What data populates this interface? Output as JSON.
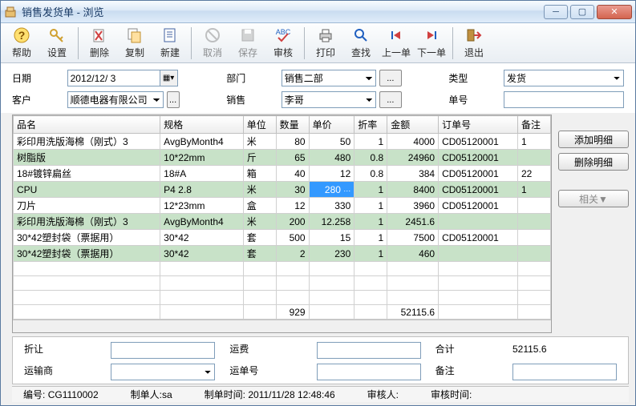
{
  "window_title": "销售发货单 - 浏览",
  "toolbar": {
    "help": "帮助",
    "setup": "设置",
    "delete": "删除",
    "copy": "复制",
    "new": "新建",
    "cancel": "取消",
    "save": "保存",
    "audit": "审核",
    "print": "打印",
    "find": "查找",
    "prev": "上一单",
    "next": "下一单",
    "exit": "退出"
  },
  "form": {
    "date_label": "日期",
    "date_value": "2012/12/ 3",
    "dept_label": "部门",
    "dept_value": "销售二部",
    "type_label": "类型",
    "type_value": "发货",
    "cust_label": "客户",
    "cust_value": "顺德电器有限公司",
    "sale_label": "销售",
    "sale_value": "李哥",
    "doc_label": "单号",
    "doc_value": "",
    "dots": "..."
  },
  "grid": {
    "cols": [
      "品名",
      "规格",
      "单位",
      "数量",
      "单价",
      "折率",
      "金额",
      "订单号",
      "备注"
    ],
    "rows": [
      {
        "name": "彩印用洗版海棉（刚式）3",
        "spec": "AvgByMonth4",
        "unit": "米",
        "qty": "80",
        "price": "50",
        "disc": "1",
        "amt": "4000",
        "ord": "CD05120001",
        "rem": "1"
      },
      {
        "name": "树脂版",
        "spec": "10*22mm",
        "unit": "斤",
        "qty": "65",
        "price": "480",
        "disc": "0.8",
        "amt": "24960",
        "ord": "CD05120001",
        "rem": ""
      },
      {
        "name": "18#镀锌扁丝",
        "spec": "18#A",
        "unit": "箱",
        "qty": "40",
        "price": "12",
        "disc": "0.8",
        "amt": "384",
        "ord": "CD05120001",
        "rem": "22"
      },
      {
        "name": "CPU",
        "spec": "P4 2.8",
        "unit": "米",
        "qty": "30",
        "price": "280",
        "disc": "1",
        "amt": "8400",
        "ord": "CD05120001",
        "rem": "1",
        "editing": "price"
      },
      {
        "name": "刀片",
        "spec": "12*23mm",
        "unit": "盒",
        "qty": "12",
        "price": "330",
        "disc": "1",
        "amt": "3960",
        "ord": "CD05120001",
        "rem": ""
      },
      {
        "name": "彩印用洗版海棉（刚式）3",
        "spec": "AvgByMonth4",
        "unit": "米",
        "qty": "200",
        "price": "12.258",
        "disc": "1",
        "amt": "2451.6",
        "ord": "",
        "rem": ""
      },
      {
        "name": "30*42塑封袋（票据用）",
        "spec": "30*42",
        "unit": "套",
        "qty": "500",
        "price": "15",
        "disc": "1",
        "amt": "7500",
        "ord": "CD05120001",
        "rem": ""
      },
      {
        "name": "30*42塑封袋（票据用）",
        "spec": "30*42",
        "unit": "套",
        "qty": "2",
        "price": "230",
        "disc": "1",
        "amt": "460",
        "ord": "",
        "rem": ""
      }
    ],
    "totals": {
      "qty": "929",
      "amt": "52115.6"
    }
  },
  "side": {
    "add": "添加明细",
    "del": "删除明细",
    "rel": "相关▼"
  },
  "bottom": {
    "discount_label": "折让",
    "discount_value": "",
    "freight_label": "运费",
    "freight_value": "",
    "total_label": "合计",
    "total_value": "52115.6",
    "carrier_label": "运输商",
    "carrier_value": "",
    "waybill_label": "运单号",
    "waybill_value": "",
    "remark_label": "备注",
    "remark_value": ""
  },
  "status": {
    "no_label": "编号:",
    "no_value": "CG1110002",
    "creator_label": "制单人:",
    "creator_value": "sa",
    "ctime_label": "制单时间:",
    "ctime_value": "2011/11/28 12:48:46",
    "auditor_label": "审核人:",
    "auditor_value": "",
    "atime_label": "审核时间:",
    "atime_value": ""
  }
}
